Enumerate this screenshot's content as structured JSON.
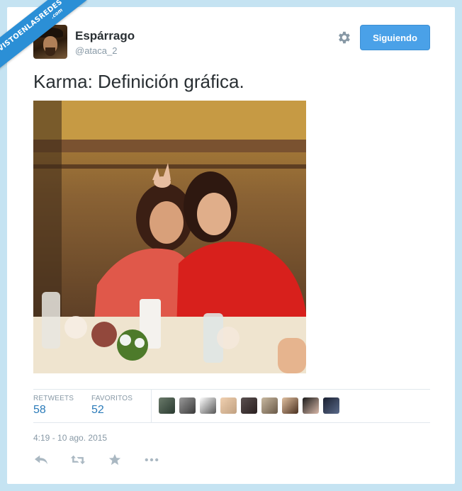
{
  "watermark": {
    "main": "VISTOENLASREDES",
    "sub": ".com"
  },
  "user": {
    "name": "Espárrago",
    "handle": "@ataca_2"
  },
  "follow_button": {
    "label": "Siguiendo"
  },
  "tweet": {
    "text": "Karma: Definición gráfica."
  },
  "stats": {
    "retweets_label": "RETWEETS",
    "retweets_value": "58",
    "favorites_label": "FAVORITOS",
    "favorites_value": "52"
  },
  "favoriters_count": 9,
  "timestamp": "4:19 - 10 ago. 2015",
  "actions": [
    "reply-icon",
    "retweet-icon",
    "favorite-icon",
    "more-icon"
  ],
  "colors": {
    "accent": "#4aa1e8",
    "link": "#2b7bb9",
    "muted": "#8899a6",
    "background": "#c5e3f2"
  }
}
